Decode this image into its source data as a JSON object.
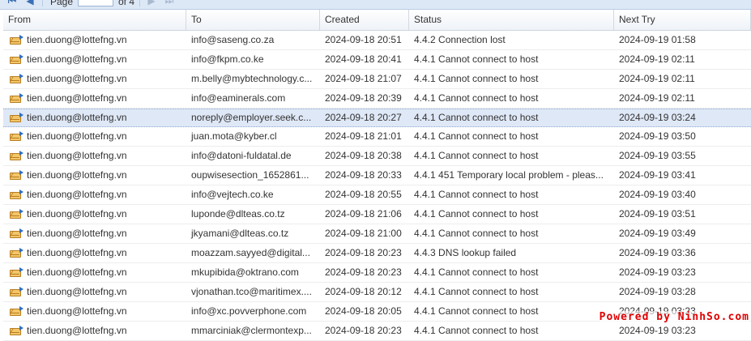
{
  "toolbar": {
    "page_label": "Page",
    "page_of": "of 4"
  },
  "columns": {
    "from": "From",
    "to": "To",
    "created": "Created",
    "status": "Status",
    "next_try": "Next Try"
  },
  "rows": [
    {
      "from": "tien.duong@lottefng.vn",
      "to": "info@saseng.co.za",
      "created": "2024-09-18 20:51",
      "status": "4.4.2 Connection lost",
      "next": "2024-09-19 01:58"
    },
    {
      "from": "tien.duong@lottefng.vn",
      "to": "info@fkpm.co.ke",
      "created": "2024-09-18 20:41",
      "status": "4.4.1 Cannot connect to host",
      "next": "2024-09-19 02:11"
    },
    {
      "from": "tien.duong@lottefng.vn",
      "to": "m.belly@mybtechnology.c...",
      "created": "2024-09-18 21:07",
      "status": "4.4.1 Cannot connect to host",
      "next": "2024-09-19 02:11"
    },
    {
      "from": "tien.duong@lottefng.vn",
      "to": "info@eaminerals.com",
      "created": "2024-09-18 20:39",
      "status": "4.4.1 Cannot connect to host",
      "next": "2024-09-19 02:11"
    },
    {
      "from": "tien.duong@lottefng.vn",
      "to": "noreply@employer.seek.c...",
      "created": "2024-09-18 20:27",
      "status": "4.4.1 Cannot connect to host",
      "next": "2024-09-19 03:24"
    },
    {
      "from": "tien.duong@lottefng.vn",
      "to": "juan.mota@kyber.cl",
      "created": "2024-09-18 21:01",
      "status": "4.4.1 Cannot connect to host",
      "next": "2024-09-19 03:50"
    },
    {
      "from": "tien.duong@lottefng.vn",
      "to": "info@datoni-fuldatal.de",
      "created": "2024-09-18 20:38",
      "status": "4.4.1 Cannot connect to host",
      "next": "2024-09-19 03:55"
    },
    {
      "from": "tien.duong@lottefng.vn",
      "to": "oupwisesection_1652861...",
      "created": "2024-09-18 20:33",
      "status": "4.4.1 451 Temporary local problem - pleas...",
      "next": "2024-09-19 03:41"
    },
    {
      "from": "tien.duong@lottefng.vn",
      "to": "info@vejtech.co.ke",
      "created": "2024-09-18 20:55",
      "status": "4.4.1 Cannot connect to host",
      "next": "2024-09-19 03:40"
    },
    {
      "from": "tien.duong@lottefng.vn",
      "to": "luponde@dlteas.co.tz",
      "created": "2024-09-18 21:06",
      "status": "4.4.1 Cannot connect to host",
      "next": "2024-09-19 03:51"
    },
    {
      "from": "tien.duong@lottefng.vn",
      "to": "jkyamani@dlteas.co.tz",
      "created": "2024-09-18 21:00",
      "status": "4.4.1 Cannot connect to host",
      "next": "2024-09-19 03:49"
    },
    {
      "from": "tien.duong@lottefng.vn",
      "to": "moazzam.sayyed@digital...",
      "created": "2024-09-18 20:23",
      "status": "4.4.3 DNS lookup failed",
      "next": "2024-09-19 03:36"
    },
    {
      "from": "tien.duong@lottefng.vn",
      "to": "mkupibida@oktrano.com",
      "created": "2024-09-18 20:23",
      "status": "4.4.1 Cannot connect to host",
      "next": "2024-09-19 03:23"
    },
    {
      "from": "tien.duong@lottefng.vn",
      "to": "vjonathan.tco@maritimex....",
      "created": "2024-09-18 20:12",
      "status": "4.4.1 Cannot connect to host",
      "next": "2024-09-19 03:28"
    },
    {
      "from": "tien.duong@lottefng.vn",
      "to": "info@xc.povverphone.com",
      "created": "2024-09-18 20:05",
      "status": "4.4.1 Cannot connect to host",
      "next": "2024-09-19 03:23"
    },
    {
      "from": "tien.duong@lottefng.vn",
      "to": "mmarciniak@clermontexp...",
      "created": "2024-09-18 20:23",
      "status": "4.4.1 Cannot connect to host",
      "next": "2024-09-19 03:23"
    }
  ],
  "selected_row": 4,
  "watermark": "Powered by NinhSo.com",
  "icons": {
    "row_icon": "mail-queue-icon",
    "first": "first-page-icon",
    "prev": "prev-page-icon",
    "next": "next-page-icon",
    "last": "last-page-icon"
  },
  "colors": {
    "selected_row": "#dfe8f6",
    "toolbar": "#dde8f6",
    "watermark": "#e00000"
  }
}
